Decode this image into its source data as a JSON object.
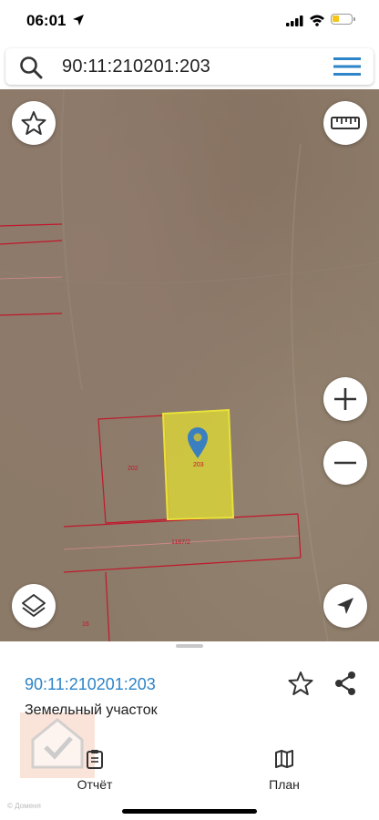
{
  "status": {
    "time": "06:01",
    "icons": [
      "location-arrow-icon",
      "signal-icon",
      "wifi-icon",
      "battery-icon"
    ],
    "battery_color": "#f5c518"
  },
  "search": {
    "value": "90:11:210201:203",
    "icons": [
      "search-icon",
      "menu-icon"
    ]
  },
  "map": {
    "buttons": [
      "favorite-star-icon",
      "ruler-icon",
      "zoom-in-icon",
      "zoom-out-icon",
      "layers-icon",
      "locate-me-icon"
    ],
    "parcels": {
      "left": "202",
      "selected": "203",
      "road": "1187/2",
      "bottom": "16"
    },
    "colors": {
      "boundary": "#c0182c",
      "selected_fill": "#d8d23a",
      "marker": "#3a7fc0"
    }
  },
  "sheet": {
    "cadastral_number": "90:11:210201:203",
    "object_type": "Земельный участок",
    "tabs": [
      {
        "label": "Отчёт",
        "icon": "report-clipboard-icon"
      },
      {
        "label": "План",
        "icon": "plan-map-icon"
      }
    ],
    "credit": "© Доменя",
    "accent": "#2d84c8"
  }
}
